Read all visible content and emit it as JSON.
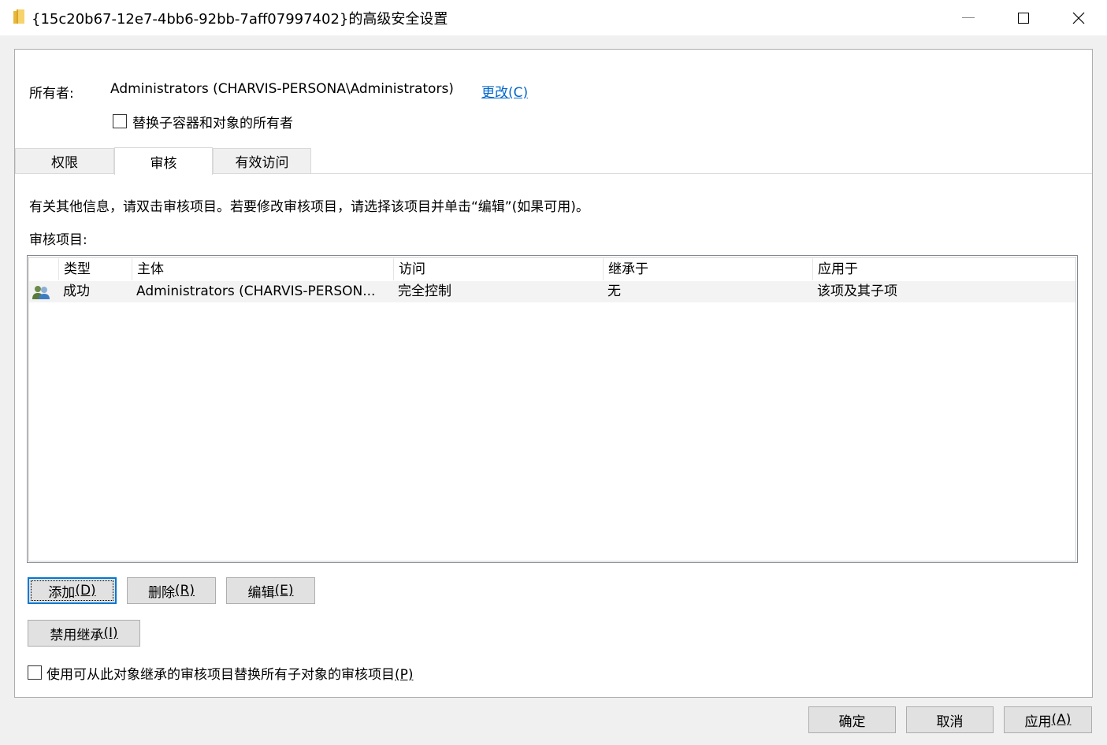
{
  "window": {
    "title": "{15c20b67-12e7-4bb6-92bb-7aff07997402}的高级安全设置",
    "icon": "folder-icon"
  },
  "owner": {
    "label": "所有者:",
    "value": "Administrators (CHARVIS-PERSONA\\Administrators)",
    "change_link": "更改(C)",
    "replace_checkbox_label": "替换子容器和对象的所有者",
    "replace_checked": false
  },
  "tabs": [
    {
      "label": "权限",
      "active": false
    },
    {
      "label": "审核",
      "active": true
    },
    {
      "label": "有效访问",
      "active": false
    }
  ],
  "audit": {
    "info_text": "有关其他信息，请双击审核项目。若要修改审核项目，请选择该项目并单击“编辑”(如果可用)。",
    "entries_label": "审核项目:",
    "columns": [
      "类型",
      "主体",
      "访问",
      "继承于",
      "应用于"
    ],
    "rows": [
      {
        "icon": "users-icon",
        "type": "成功",
        "principal": "Administrators (CHARVIS-PERSON...",
        "access": "完全控制",
        "inherited_from": "无",
        "applies_to": "该项及其子项"
      }
    ]
  },
  "buttons": {
    "add": {
      "text": "添加",
      "key": "(D)"
    },
    "remove": {
      "text": "删除",
      "key": "(R)"
    },
    "edit": {
      "text": "编辑",
      "key": "(E)"
    },
    "disable_inheritance": {
      "text": "禁用继承",
      "key": "(I)"
    },
    "ok": "确定",
    "cancel": "取消",
    "apply": {
      "text": "应用",
      "key": "(A)"
    }
  },
  "replace_audit": {
    "label": "使用可从此对象继承的审核项目替换所有子对象的审核项目",
    "key": "(P)",
    "checked": false
  },
  "colors": {
    "link": "#0066cc",
    "focus": "#0078d7",
    "button_bg": "#e1e1e1",
    "selected_row": "#f3f3f3"
  }
}
